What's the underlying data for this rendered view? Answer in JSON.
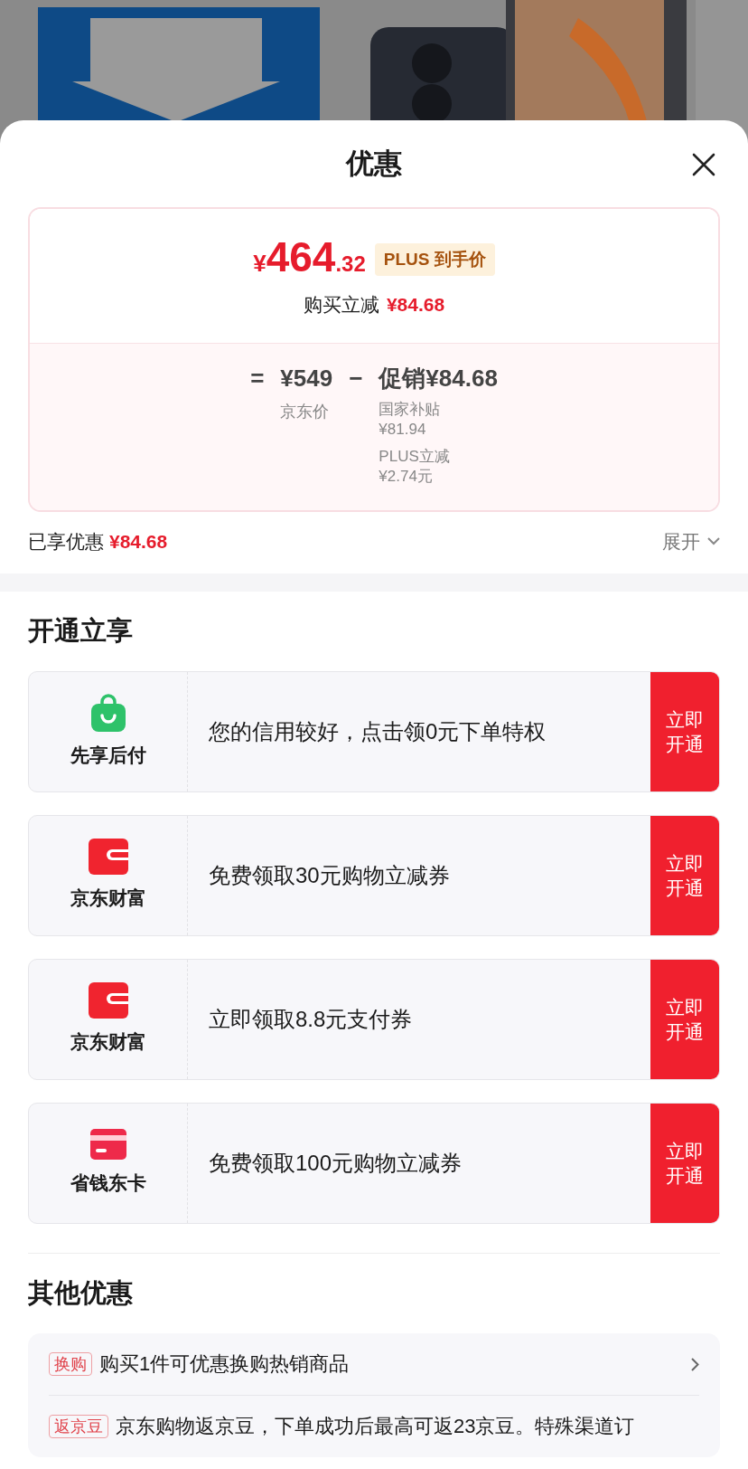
{
  "sheet": {
    "title": "优惠"
  },
  "price_card": {
    "price_symbol": "¥",
    "price_main": "464",
    "price_decimal": ".32",
    "price_tag": "PLUS 到手价",
    "reduction_label": "购买立减",
    "reduction_value": "¥84.68",
    "equation": {
      "equals": "=",
      "base_price": "¥549",
      "base_label": "京东价",
      "minus": "−",
      "discount": "促销¥84.68",
      "discount_details": [
        {
          "label": "国家补贴",
          "value": "¥81.94"
        },
        {
          "label": "PLUS立减",
          "value": "¥2.74元"
        }
      ]
    }
  },
  "enjoyed": {
    "label": "已享优惠",
    "value": "¥84.68",
    "expand": "展开"
  },
  "open_section": {
    "title": "开通立享",
    "offers": [
      {
        "kind": "bag",
        "name": "先享后付",
        "text": "您的信用较好，点击领0元下单特权",
        "button": "立即开通"
      },
      {
        "kind": "wallet",
        "name": "京东财富",
        "text": "免费领取30元购物立减券",
        "button": "立即开通"
      },
      {
        "kind": "wallet",
        "name": "京东财富",
        "text": "立即领取8.8元支付券",
        "button": "立即开通"
      },
      {
        "kind": "card",
        "name": "省钱东卡",
        "text": "免费领取100元购物立减券",
        "button": "立即开通"
      }
    ]
  },
  "other_section": {
    "title": "其他优惠",
    "items": [
      {
        "tag": "换购",
        "text": "购买1件可优惠换购热销商品",
        "has_arrow": true
      },
      {
        "tag": "返京豆",
        "text": "京东购物返京豆，下单成功后最高可返23京豆。特殊渠道订",
        "has_arrow": false
      }
    ]
  }
}
